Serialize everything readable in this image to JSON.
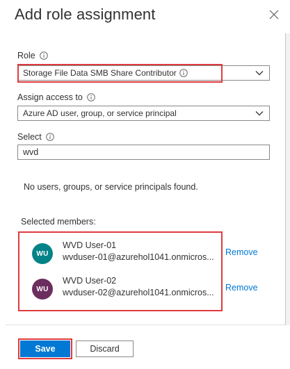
{
  "panel": {
    "title": "Add role assignment",
    "close_icon": "close-icon"
  },
  "role": {
    "label": "Role",
    "value": "Storage File Data SMB Share Contributor"
  },
  "assign_access": {
    "label": "Assign access to",
    "value": "Azure AD user, group, or service principal"
  },
  "select": {
    "label": "Select",
    "value": "wvd",
    "empty_message": "No users, groups, or service principals found."
  },
  "selected_members": {
    "label": "Selected members:",
    "items": [
      {
        "initials": "WU",
        "name": "WVD User-01",
        "email": "wvduser-01@azurehol1041.onmicros...",
        "action": "Remove",
        "avatar_color": "#038387"
      },
      {
        "initials": "WU",
        "name": "WVD User-02",
        "email": "wvduser-02@azurehol1041.onmicros...",
        "action": "Remove",
        "avatar_color": "#6b2e5f"
      }
    ]
  },
  "footer": {
    "save_label": "Save",
    "discard_label": "Discard"
  },
  "colors": {
    "accent": "#0078d4",
    "highlight": "#e03a3e"
  }
}
